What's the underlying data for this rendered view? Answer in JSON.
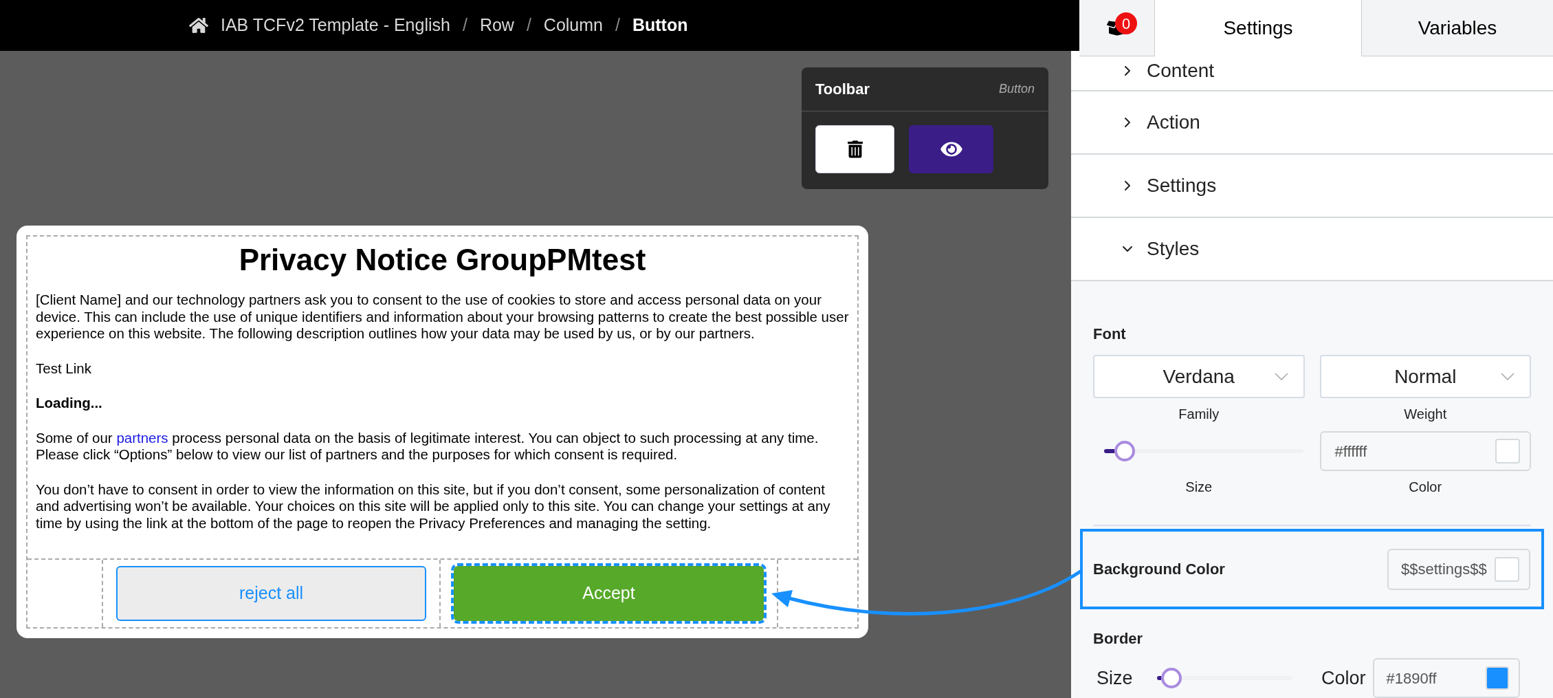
{
  "breadcrumb": [
    {
      "label": "IAB TCFv2 Template - English",
      "current": false
    },
    {
      "separator": "/",
      "label": "Row",
      "current": false
    },
    {
      "separator": "/",
      "label": "Column",
      "current": false
    },
    {
      "separator": "/",
      "label": "Button",
      "current": true
    }
  ],
  "toolbar": {
    "title": "Toolbar",
    "element_type": "Button"
  },
  "notice": {
    "title": "Privacy Notice GroupPMtest",
    "paragraphs": [
      {
        "kind": "text",
        "text": "[Client Name] and our technology partners ask you to consent to the use of cookies to store and access personal data on your device. This can include the use of unique identifiers and information about your browsing patterns to create the best possible user experience on this website. The following description outlines how your data may be used by us, or by our partners."
      },
      {
        "kind": "text",
        "text": "Test Link"
      },
      {
        "kind": "bold",
        "text": "Loading..."
      },
      {
        "kind": "link",
        "before": "Some of our",
        "link": "partners",
        "after": "process personal data on the basis of legitimate interest. You can object to such processing at any time. Please click “Options” below to view our list of partners and the purposes for which consent is required."
      },
      {
        "kind": "text",
        "text": "You don’t have to consent in order to view the information on this site, but if you don’t consent, some personalization of content and advertising won’t be available. Your choices on this site will be applied only to this site. You can change your settings at any time by using the link at the bottom of the page to reopen the Privacy Preferences and managing the setting."
      }
    ],
    "buttons": [
      {
        "label": "reject all",
        "kind": "secondary",
        "selected": false
      },
      {
        "label": "Accept",
        "kind": "primary",
        "selected": true
      }
    ]
  },
  "panel": {
    "badge": "0",
    "tabs": [
      {
        "label": "Settings",
        "selected": true
      },
      {
        "label": "Variables",
        "selected": false
      }
    ],
    "sections": [
      {
        "label": "Content",
        "expanded": false
      },
      {
        "label": "Action",
        "expanded": false
      },
      {
        "label": "Settings",
        "expanded": false
      },
      {
        "label": "Styles",
        "expanded": true
      }
    ],
    "font": {
      "label": "Font",
      "family": {
        "value": "Verdana",
        "caption": "Family"
      },
      "weight": {
        "value": "Normal",
        "caption": "Weight"
      },
      "size": {
        "caption": "Size",
        "level": 0.05
      },
      "color": {
        "value": "#ffffff",
        "caption": "Color"
      }
    },
    "background": {
      "label": "Background Color",
      "value": "$$settings$$",
      "highlighted": true
    },
    "border": {
      "label": "Border",
      "size_label": "Size",
      "level": 0.03,
      "color_label": "Color",
      "color_value": "#1890ff"
    }
  }
}
